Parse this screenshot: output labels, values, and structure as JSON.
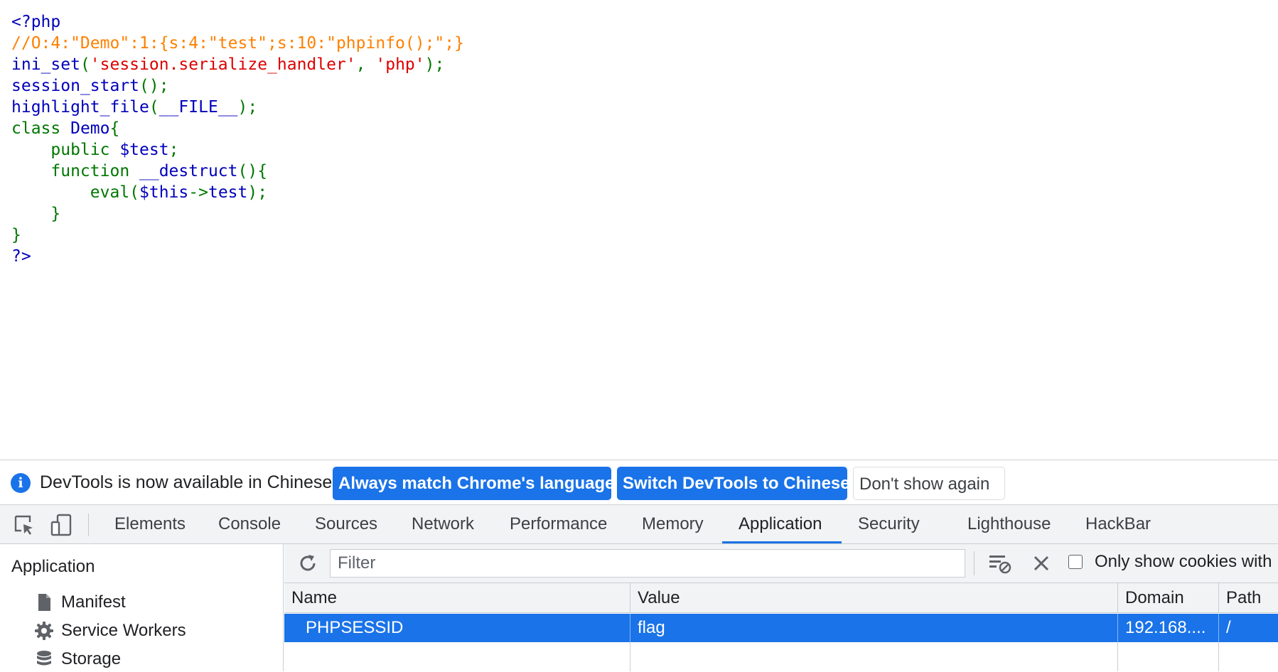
{
  "source_code": {
    "line1": "<?php",
    "line2": "//O:4:\"Demo\":1:{s:4:\"test\";s:10:\"phpinfo();\";}",
    "line3_func": "ini_set",
    "line3_open": "(",
    "line3_arg1": "'session.serialize_handler'",
    "line3_comma": ", ",
    "line3_arg2": "'php'",
    "line3_close": ");",
    "line4_func": "session_start",
    "line4_rest": "();",
    "line5_func": "highlight_file",
    "line5_open": "(",
    "line5_const": "__FILE__",
    "line5_close": ");",
    "line6_kw": "class ",
    "line6_name": "Demo",
    "line6_brace": "{",
    "line7_kw": "    public ",
    "line7_var": "$test",
    "line7_end": ";",
    "line8_kw": "    function ",
    "line8_name": "__destruct",
    "line8_end": "(){",
    "line9_kw": "        eval(",
    "line9_var": "$this",
    "line9_arrow": "->",
    "line9_prop": "test",
    "line9_end": ");",
    "line10": "    }",
    "line11": "}",
    "line12": "?>"
  },
  "infobar": {
    "message": "DevTools is now available in Chinese!",
    "btn_match": "Always match Chrome's language",
    "btn_switch": "Switch DevTools to Chinese",
    "btn_dont": "Don't show again"
  },
  "tabs": {
    "elements": "Elements",
    "console": "Console",
    "sources": "Sources",
    "network": "Network",
    "performance": "Performance",
    "memory": "Memory",
    "application": "Application",
    "security": "Security",
    "lighthouse": "Lighthouse",
    "hackbar": "HackBar",
    "active": "Application"
  },
  "sidebar": {
    "title": "Application",
    "items": [
      {
        "label": "Manifest",
        "icon": "file-icon"
      },
      {
        "label": "Service Workers",
        "icon": "gear-icon"
      },
      {
        "label": "Storage",
        "icon": "database-icon"
      }
    ]
  },
  "toolbar": {
    "filter_placeholder": "Filter",
    "only_show_label": "Only show cookies with",
    "only_show_checked": false
  },
  "cookie_table": {
    "columns": [
      "Name",
      "Value",
      "Domain",
      "Path"
    ],
    "rows": [
      {
        "name": "PHPSESSID",
        "value": "flag",
        "domain": "192.168....",
        "path": "/",
        "selected": true
      }
    ]
  },
  "colors": {
    "accent": "#1a73e8",
    "php_default": "#0000BB",
    "php_comment": "#FF8000",
    "php_string": "#DD0000",
    "php_keyword": "#007700"
  }
}
